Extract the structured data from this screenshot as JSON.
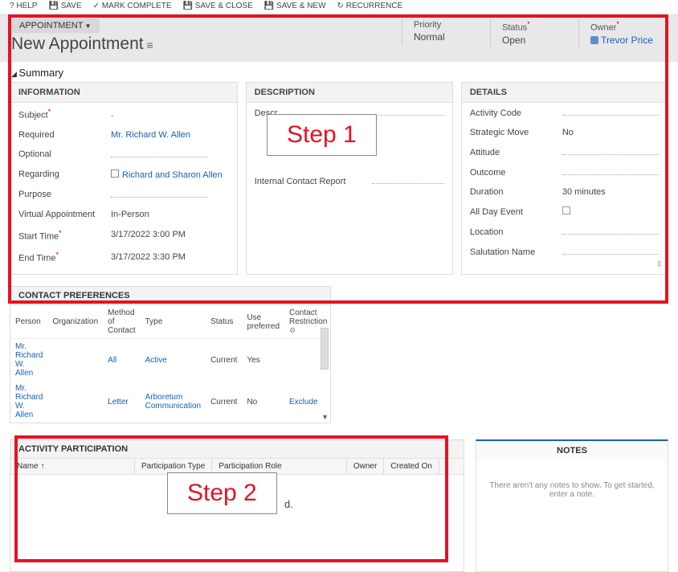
{
  "toolbar": {
    "help": "HELP",
    "save": "SAVE",
    "mark_complete": "MARK COMPLETE",
    "save_close": "SAVE & CLOSE",
    "save_new": "SAVE & NEW",
    "recurrence": "RECURRENCE"
  },
  "header": {
    "type_label": "APPOINTMENT",
    "title": "New Appointment",
    "priority_label": "Priority",
    "priority_value": "Normal",
    "status_label": "Status",
    "status_value": "Open",
    "owner_label": "Owner",
    "owner_value": "Trevor Price"
  },
  "summary_label": "Summary",
  "information": {
    "header": "INFORMATION",
    "subject_label": "Subject",
    "subject_value": ".",
    "required_label": "Required",
    "required_value": "Mr. Richard W. Allen",
    "optional_label": "Optional",
    "regarding_label": "Regarding",
    "regarding_value": "Richard and Sharon Allen",
    "purpose_label": "Purpose",
    "virtual_label": "Virtual Appointment",
    "virtual_value": "In-Person",
    "start_label": "Start Time",
    "start_value": "3/17/2022  3:00 PM",
    "end_label": "End Time",
    "end_value": "3/17/2022  3:30 PM"
  },
  "description": {
    "header": "DESCRIPTION",
    "desc_label": "Descr",
    "icr_label": "Internal Contact Report"
  },
  "details": {
    "header": "DETAILS",
    "activity_code_label": "Activity Code",
    "strategic_label": "Strategic Move",
    "strategic_value": "No",
    "attitude_label": "Attitude",
    "outcome_label": "Outcome",
    "duration_label": "Duration",
    "duration_value": "30 minutes",
    "allday_label": "All Day Event",
    "location_label": "Location",
    "salutation_label": "Salutation Name"
  },
  "contact_prefs": {
    "header": "CONTACT PREFERENCES",
    "cols": {
      "person": "Person",
      "organization": "Organization",
      "method": "Method of Contact",
      "type": "Type",
      "status": "Status",
      "use_pref": "Use preferred",
      "restriction": "Contact Restriction"
    },
    "rows": [
      {
        "person": "Mr. Richard W. Allen",
        "org": "",
        "method": "All",
        "type": "Active",
        "status": "Current",
        "use_pref": "Yes",
        "restriction": ""
      },
      {
        "person": "Mr. Richard W. Allen",
        "org": "",
        "method": "Letter",
        "type": "Arboretum Communication",
        "status": "Current",
        "use_pref": "No",
        "restriction": "Exclude"
      }
    ]
  },
  "activity": {
    "header": "ACTIVITY PARTICIPATION",
    "cols": {
      "name": "Name ↑",
      "ptype": "Participation Type",
      "prole": "Participation Role",
      "owner": "Owner",
      "created": "Created On"
    },
    "trailing": "d."
  },
  "notes": {
    "header": "NOTES",
    "empty": "There aren't any notes to show. To get started, enter a note."
  },
  "annotations": {
    "step1": "Step 1",
    "step2": "Step 2"
  }
}
